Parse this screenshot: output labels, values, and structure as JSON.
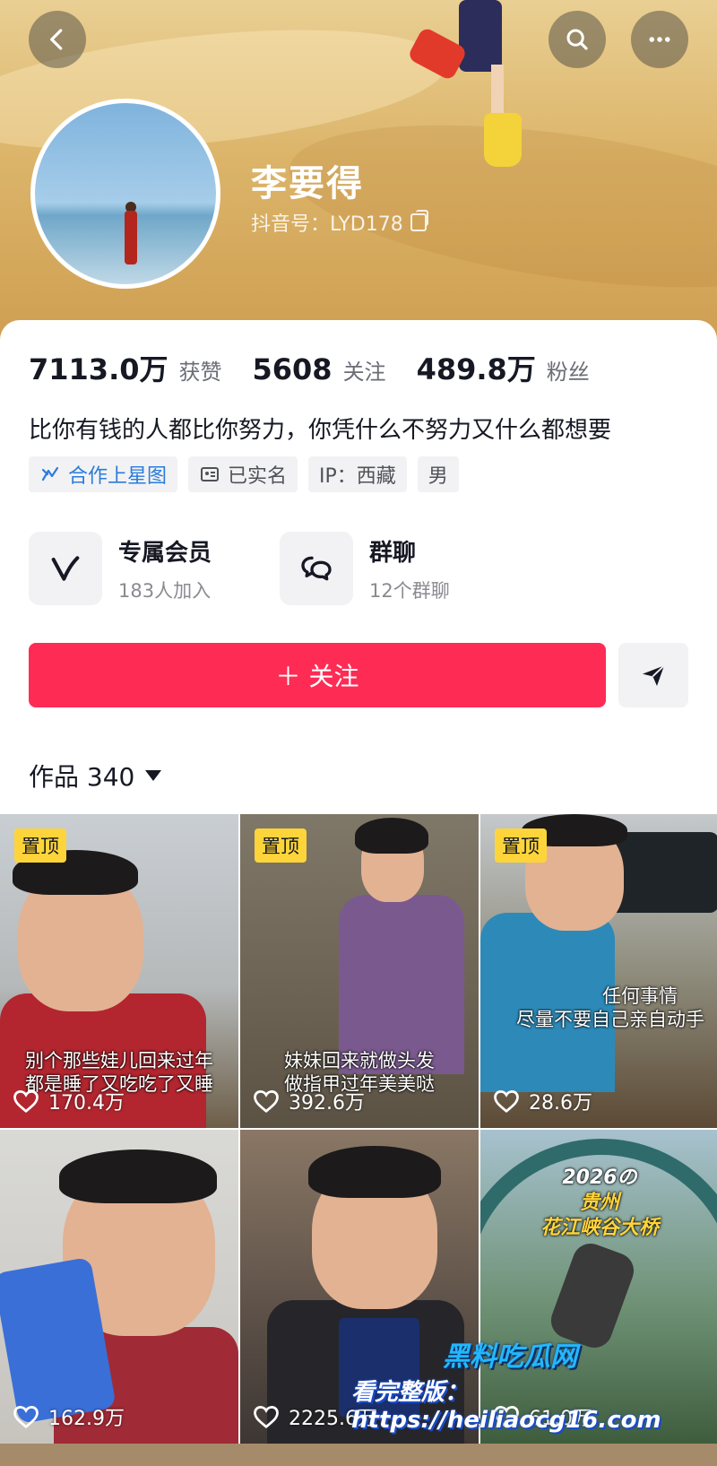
{
  "profile": {
    "name": "李要得",
    "douyin_id": "抖音号：LYD178"
  },
  "stats": [
    {
      "value": "7113.0万",
      "label": "获赞"
    },
    {
      "value": "5608",
      "label": "关注"
    },
    {
      "value": "489.8万",
      "label": "粉丝"
    }
  ],
  "bio": "比你有钱的人都比你努力，你凭什么不努力又什么都想要",
  "tags": [
    "合作上星图",
    "已实名",
    "IP：西藏",
    "男"
  ],
  "features": [
    {
      "title": "专属会员",
      "subtitle": "183人加入",
      "icon": "v-icon"
    },
    {
      "title": "群聊",
      "subtitle": "12个群聊",
      "icon": "group-chat-icon"
    }
  ],
  "actions": {
    "follow_label": "＋ 关注"
  },
  "works": {
    "label": "作品 340"
  },
  "videos": [
    {
      "pinned_label": "置顶",
      "caption": [
        "别个那些娃儿回来过年",
        "都是睡了又吃吃了又睡"
      ],
      "likes": "170.4万"
    },
    {
      "pinned_label": "置顶",
      "caption": [
        "妹妹回来就做头发",
        "做指甲过年美美哒"
      ],
      "likes": "392.6万"
    },
    {
      "pinned_label": "置顶",
      "caption": [
        "任何事情",
        "尽量不要自己亲自动手"
      ],
      "likes": "28.6万"
    },
    {
      "pinned_label": "",
      "caption": [],
      "likes": "162.9万"
    },
    {
      "pinned_label": "",
      "caption": [],
      "likes": "2225.6万"
    },
    {
      "pinned_label": "",
      "caption": [
        "2026の",
        "贵州",
        "花江峡谷大桥"
      ],
      "likes": "61.0万"
    }
  ],
  "watermark": {
    "line1": "黑料吃瓜网",
    "line2": "看完整版：https://heiliaocg16.com"
  },
  "colors": {
    "accent": "#fe2c55",
    "pin": "#fdd53a",
    "tag_blue": "#2a7cdb"
  }
}
